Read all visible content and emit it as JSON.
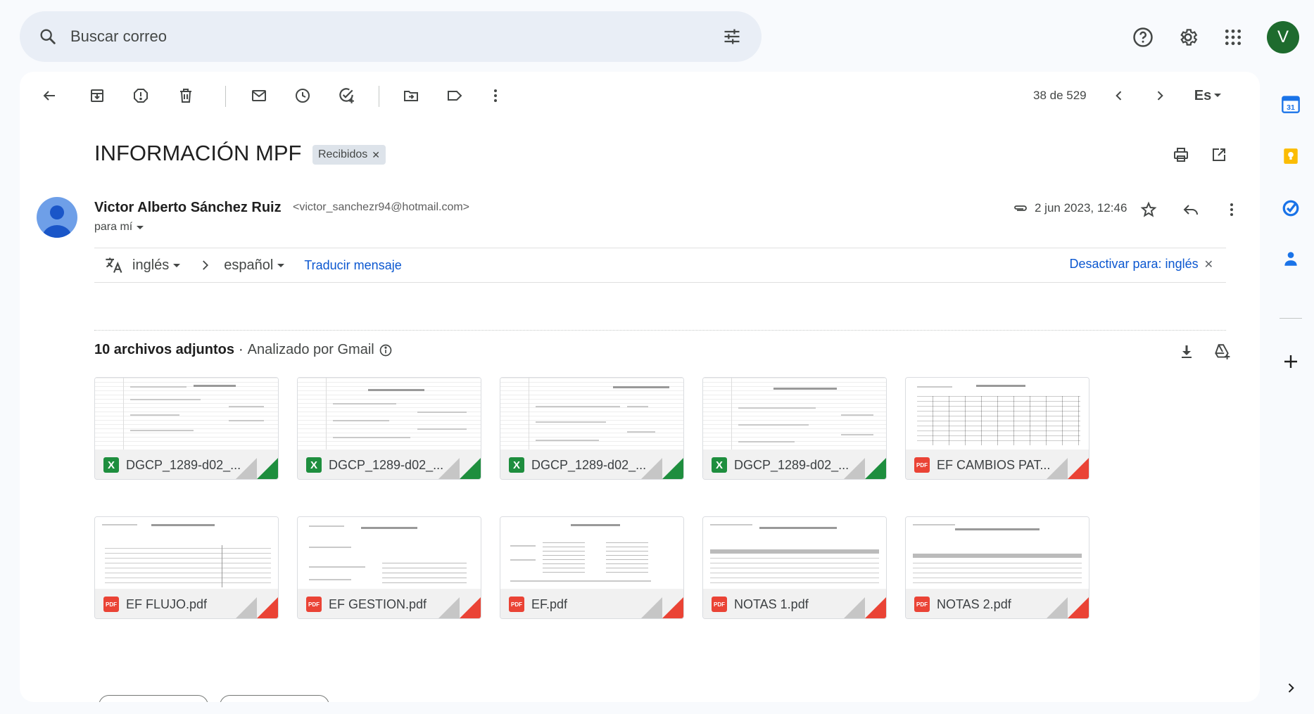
{
  "search": {
    "placeholder": "Buscar correo"
  },
  "toolbar": {
    "counter": "38 de 529",
    "lang_short": "Es"
  },
  "email": {
    "subject": "INFORMACIÓN MPF",
    "label": "Recibidos",
    "sender_name": "Victor Alberto Sánchez Ruiz",
    "sender_email": "<victor_sanchezr94@hotmail.com>",
    "to": "para mí",
    "date": "2 jun 2023, 12:46"
  },
  "translate": {
    "from": "inglés",
    "to": "español",
    "action": "Traducir mensaje",
    "disable": "Desactivar para: inglés"
  },
  "attachments": {
    "count_label": "10 archivos adjuntos",
    "bullet": "·",
    "analyzed": "Analizado por Gmail",
    "items": [
      {
        "name": "DGCP_1289-d02_...",
        "type": "xlsx"
      },
      {
        "name": "DGCP_1289-d02_...",
        "type": "xlsx"
      },
      {
        "name": "DGCP_1289-d02_...",
        "type": "xlsx"
      },
      {
        "name": "DGCP_1289-d02_...",
        "type": "xlsx"
      },
      {
        "name": "EF CAMBIOS PAT...",
        "type": "pdf"
      },
      {
        "name": "EF FLUJO.pdf",
        "type": "pdf"
      },
      {
        "name": "EF GESTION.pdf",
        "type": "pdf"
      },
      {
        "name": "EF.pdf",
        "type": "pdf"
      },
      {
        "name": "NOTAS 1.pdf",
        "type": "pdf"
      },
      {
        "name": "NOTAS 2.pdf",
        "type": "pdf"
      }
    ]
  },
  "file_badges": {
    "xlsx": "X",
    "pdf": "PDF"
  },
  "user": {
    "initial": "V"
  },
  "colors": {
    "accent": "#0b57d0",
    "avatar": "#1e6b2e",
    "xlsx": "#1e8e3e",
    "pdf": "#ea4335"
  }
}
